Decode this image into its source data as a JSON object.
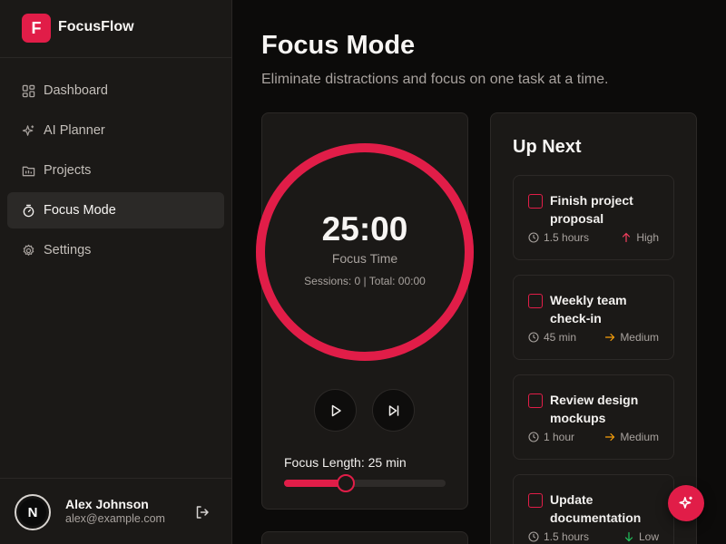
{
  "app": {
    "name": "FocusFlow",
    "logo_letter": "F"
  },
  "sidebar": {
    "items": [
      {
        "label": "Dashboard",
        "icon": "dashboard-icon",
        "active": false
      },
      {
        "label": "AI Planner",
        "icon": "sparkles-icon",
        "active": false
      },
      {
        "label": "Projects",
        "icon": "folder-icon",
        "active": false
      },
      {
        "label": "Focus Mode",
        "icon": "timer-icon",
        "active": true
      },
      {
        "label": "Settings",
        "icon": "gear-icon",
        "active": false
      }
    ]
  },
  "user": {
    "initial": "N",
    "name": "Alex Johnson",
    "email": "alex@example.com"
  },
  "page": {
    "title": "Focus Mode",
    "subtitle": "Eliminate distractions and focus on one task at a time."
  },
  "timer": {
    "value": "25:00",
    "label": "Focus Time",
    "sessions": "Sessions: 0 | Total: 00:00",
    "progress": 1.0,
    "focus_length_label": "Focus Length: 25 min",
    "slider_fraction": 0.38
  },
  "up_next": {
    "title": "Up Next",
    "tasks": [
      {
        "title": "Finish project proposal",
        "time": "1.5 hours",
        "priority": "High",
        "priority_color": "#f43f5e",
        "priority_icon": "arrow-up-icon"
      },
      {
        "title": "Weekly team check-in",
        "time": "45 min",
        "priority": "Medium",
        "priority_color": "#f59e0b",
        "priority_icon": "arrow-right-icon"
      },
      {
        "title": "Review design mockups",
        "time": "1 hour",
        "priority": "Medium",
        "priority_color": "#f59e0b",
        "priority_icon": "arrow-right-icon"
      },
      {
        "title": "Update documentation",
        "time": "1.5 hours",
        "priority": "Low",
        "priority_color": "#22c55e",
        "priority_icon": "arrow-down-icon"
      }
    ]
  },
  "colors": {
    "accent": "#e11d48",
    "background": "#0c0b0a",
    "surface": "#1b1917"
  }
}
